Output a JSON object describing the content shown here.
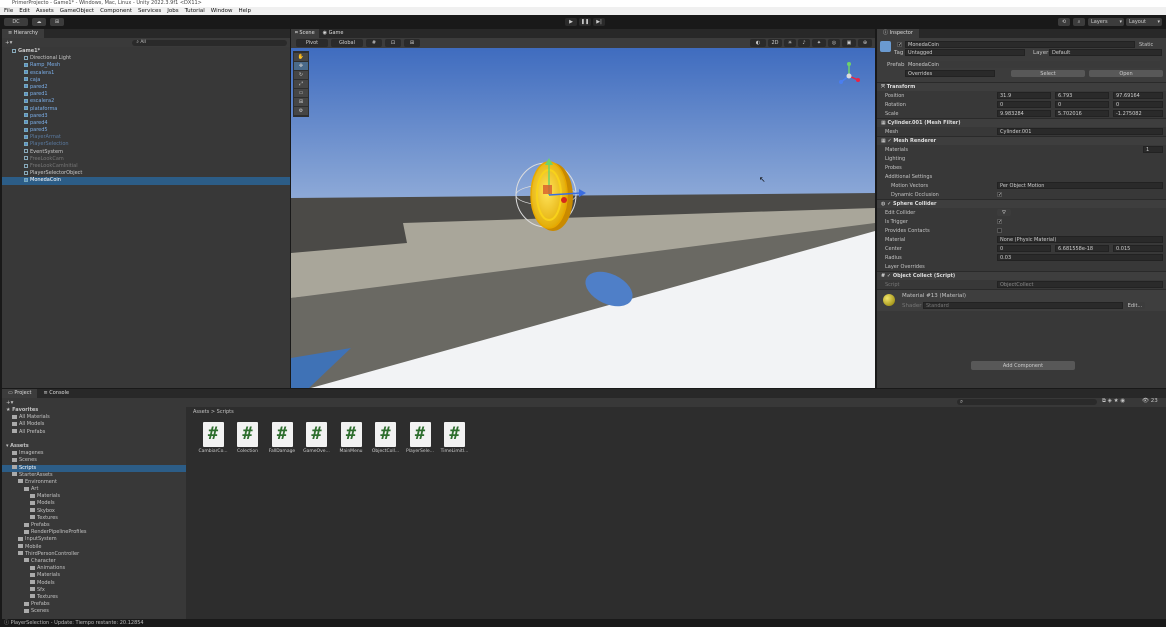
{
  "window": {
    "title": "PrimerProjecto - Game1* - Windows, Mac, Linux - Unity 2022.3.9f1 <DX11>"
  },
  "menu": [
    "File",
    "Edit",
    "Assets",
    "GameObject",
    "Component",
    "Services",
    "Jobs",
    "Tutorial",
    "Window",
    "Help"
  ],
  "toolbar": {
    "account": "DC",
    "layers": "Layers",
    "layout": "Layout"
  },
  "hierarchy": {
    "tab": "Hierarchy",
    "search": "All",
    "items": [
      {
        "label": "Game1*",
        "indent": 0,
        "style": "bold"
      },
      {
        "label": "Directional Light",
        "indent": 1,
        "style": "normal"
      },
      {
        "label": "Ramp_Mesh",
        "indent": 1,
        "style": "blue"
      },
      {
        "label": "escalera1",
        "indent": 1,
        "style": "blue"
      },
      {
        "label": "caja",
        "indent": 1,
        "style": "blue"
      },
      {
        "label": "pared2",
        "indent": 1,
        "style": "blue"
      },
      {
        "label": "pared1",
        "indent": 1,
        "style": "blue"
      },
      {
        "label": "escalera2",
        "indent": 1,
        "style": "blue"
      },
      {
        "label": "plataforma",
        "indent": 1,
        "style": "blue"
      },
      {
        "label": "pared3",
        "indent": 1,
        "style": "blue"
      },
      {
        "label": "pared4",
        "indent": 1,
        "style": "blue"
      },
      {
        "label": "pared5",
        "indent": 1,
        "style": "blue"
      },
      {
        "label": "PlayerArmat",
        "indent": 1,
        "style": "dimblue"
      },
      {
        "label": "PlayerSelection",
        "indent": 1,
        "style": "dimblue"
      },
      {
        "label": "EventSystem",
        "indent": 1,
        "style": "normal"
      },
      {
        "label": "FreeLookCam",
        "indent": 1,
        "style": "dim"
      },
      {
        "label": "FreeLookCamInitial",
        "indent": 1,
        "style": "dim"
      },
      {
        "label": "PlayerSelectorObject",
        "indent": 1,
        "style": "normal"
      },
      {
        "label": "MonedaCoin",
        "indent": 1,
        "style": "selected"
      }
    ]
  },
  "scene": {
    "tab_scene": "Scene",
    "tab_game": "Game",
    "pivot": "Pivot",
    "global": "Global",
    "mode2d": "2D"
  },
  "inspector": {
    "tab": "Inspector",
    "name": "MonedaCoin",
    "static": "Static",
    "tag": "Untagged",
    "layer": "Default",
    "prefab": "MonedaCoin",
    "overrides": "Overrides",
    "select": "Select",
    "open": "Open",
    "transform": {
      "title": "Transform",
      "position": [
        "31.9",
        "6.793",
        "97.69164"
      ],
      "rotation": [
        "0",
        "0",
        "0"
      ],
      "scale": [
        "9.983284",
        "5.702016",
        "-1.275082"
      ]
    },
    "mesh_filter": {
      "title": "Cylinder.001 (Mesh Filter)",
      "mesh_label": "Mesh",
      "mesh": "Cylinder.001"
    },
    "mesh_renderer": {
      "title": "Mesh Renderer",
      "materials": "Materials",
      "materials_count": "1",
      "lighting": "Lighting",
      "probes": "Probes",
      "additional": "Additional Settings",
      "motion_vectors_label": "Motion Vectors",
      "motion_vectors": "Per Object Motion",
      "dynamic_occlusion": "Dynamic Occlusion"
    },
    "sphere_collider": {
      "title": "Sphere Collider",
      "edit_collider": "Edit Collider",
      "is_trigger": "Is Trigger",
      "provides_contacts": "Provides Contacts",
      "material_label": "Material",
      "material": "None (Physic Material)",
      "center_label": "Center",
      "center": [
        "0",
        "6.681558e-18",
        "0.015"
      ],
      "radius_label": "Radius",
      "radius": "0.03",
      "layer_overrides": "Layer Overrides"
    },
    "script": {
      "title": "Object Collect (Script)",
      "label": "Script",
      "value": "ObjectCollect"
    },
    "material": {
      "name": "Material #13 (Material)",
      "shader_label": "Shader",
      "shader": "Standard",
      "edit": "Edit..."
    },
    "add_component": "Add Component",
    "labels": {
      "tag": "Tag",
      "layer": "Layer",
      "prefab": "Prefab",
      "position": "Position",
      "rotation": "Rotation",
      "scale": "Scale"
    }
  },
  "project": {
    "tab_project": "Project",
    "tab_console": "Console",
    "breadcrumb": "Assets > Scripts",
    "count": "23",
    "tree": [
      {
        "label": "Favorites",
        "indent": 0,
        "bold": true
      },
      {
        "label": "All Materials",
        "indent": 1
      },
      {
        "label": "All Models",
        "indent": 1
      },
      {
        "label": "All Prefabs",
        "indent": 1
      },
      {
        "label": "",
        "indent": 0
      },
      {
        "label": "Assets",
        "indent": 0,
        "bold": true
      },
      {
        "label": "Imagenes",
        "indent": 1
      },
      {
        "label": "Scenes",
        "indent": 1
      },
      {
        "label": "Scripts",
        "indent": 1,
        "selected": true
      },
      {
        "label": "StarterAssets",
        "indent": 1
      },
      {
        "label": "Environment",
        "indent": 2
      },
      {
        "label": "Art",
        "indent": 3
      },
      {
        "label": "Materials",
        "indent": 4
      },
      {
        "label": "Models",
        "indent": 4
      },
      {
        "label": "Skybox",
        "indent": 4
      },
      {
        "label": "Textures",
        "indent": 4
      },
      {
        "label": "Prefabs",
        "indent": 3
      },
      {
        "label": "RenderPipelineProfiles",
        "indent": 3
      },
      {
        "label": "InputSystem",
        "indent": 2
      },
      {
        "label": "Mobile",
        "indent": 2
      },
      {
        "label": "ThirdPersonController",
        "indent": 2
      },
      {
        "label": "Character",
        "indent": 3
      },
      {
        "label": "Animations",
        "indent": 4
      },
      {
        "label": "Materials",
        "indent": 4
      },
      {
        "label": "Models",
        "indent": 4
      },
      {
        "label": "Sfx",
        "indent": 4
      },
      {
        "label": "Textures",
        "indent": 4
      },
      {
        "label": "Prefabs",
        "indent": 3
      },
      {
        "label": "Scenes",
        "indent": 3
      }
    ],
    "assets": [
      "CambiarCo...",
      "Colection",
      "FallDamage",
      "GameOve...",
      "MainMenu",
      "ObjectColl...",
      "PlayerSele...",
      "TimeLimitI..."
    ]
  },
  "statusbar": "PlayerSelection - Update: Tiempo restante: 20.12854",
  "colors": {
    "accent": "#2c5d87",
    "coin": "#f0c419",
    "sky": "#4f7fc8"
  }
}
